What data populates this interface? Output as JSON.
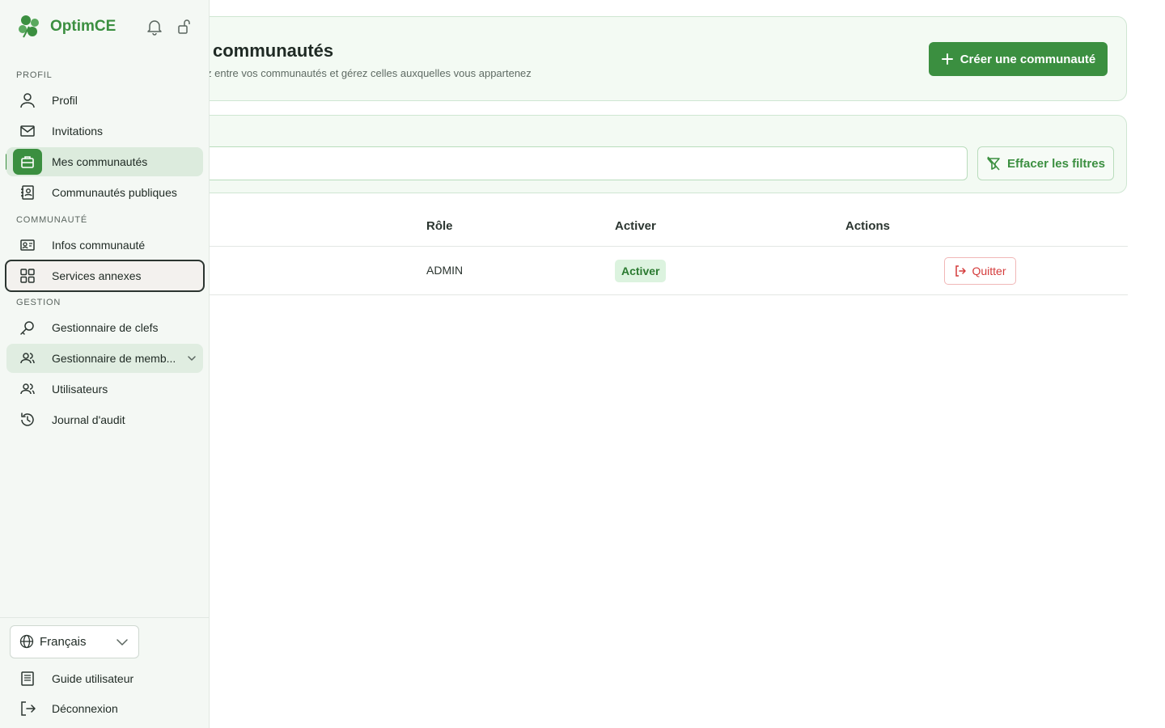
{
  "app": {
    "name": "OptimCE"
  },
  "header": {
    "title": "communautés",
    "subtitle": "z entre vos communautés et gérez celles auxquelles vous appartenez",
    "create_label": "Créer une communauté"
  },
  "filters": {
    "search_value": "",
    "clear_label": "Effacer les filtres"
  },
  "table": {
    "columns": [
      "Rôle",
      "Activer",
      "Actions"
    ],
    "rows": [
      {
        "role": "ADMIN",
        "status": "Activer",
        "action": "Quitter"
      }
    ]
  },
  "sidebar": {
    "sections": {
      "profil": "PROFIL",
      "communaute": "COMMUNAUTÉ",
      "gestion": "GESTION"
    },
    "items": [
      {
        "label": "Profil",
        "icon": "user-icon"
      },
      {
        "label": "Invitations",
        "icon": "mail-icon"
      },
      {
        "label": "Mes communautés",
        "icon": "briefcase-icon"
      },
      {
        "label": "Communautés publiques",
        "icon": "contact-book-icon"
      },
      {
        "label": "Infos communauté",
        "icon": "id-card-icon"
      },
      {
        "label": "Services annexes",
        "icon": "grid-icon"
      },
      {
        "label": "Gestionnaire de clefs",
        "icon": "key-icon"
      },
      {
        "label": "Gestionnaire de memb...",
        "icon": "users-icon"
      },
      {
        "label": "Utilisateurs",
        "icon": "users-icon"
      },
      {
        "label": "Journal d'audit",
        "icon": "history-icon"
      }
    ],
    "language": "Français",
    "guide_label": "Guide utilisateur",
    "logout_label": "Déconnexion"
  },
  "colors": {
    "accent": "#3b8f40",
    "danger": "#d43b3b",
    "badge_bg": "#dcf3df"
  }
}
